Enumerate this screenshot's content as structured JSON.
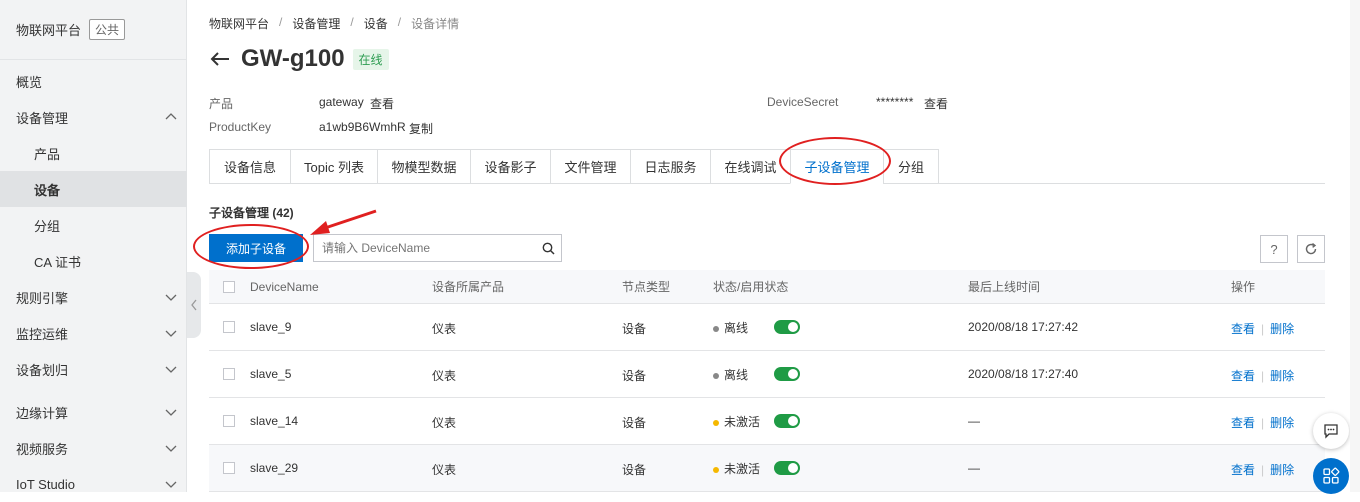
{
  "sidebar": {
    "title": "物联网平台",
    "tag": "公共",
    "items": [
      {
        "label": "概览"
      },
      {
        "label": "设备管理"
      },
      {
        "label": "产品"
      },
      {
        "label": "设备"
      },
      {
        "label": "分组"
      },
      {
        "label": "CA 证书"
      },
      {
        "label": "规则引擎"
      },
      {
        "label": "监控运维"
      },
      {
        "label": "设备划归"
      },
      {
        "label": "边缘计算"
      },
      {
        "label": "视频服务"
      },
      {
        "label": "IoT Studio"
      }
    ]
  },
  "breadcrumb": [
    "物联网平台",
    "设备管理",
    "设备",
    "设备详情"
  ],
  "device": {
    "name": "GW-g100",
    "status": "在线",
    "product_label": "产品",
    "product_value": "gateway",
    "product_link": "查看",
    "productkey_label": "ProductKey",
    "productkey_value": "a1wb9B6WmhR",
    "productkey_link": "复制",
    "secret_label": "DeviceSecret",
    "secret_value": "********",
    "secret_link": "查看"
  },
  "tabs": [
    "设备信息",
    "Topic 列表",
    "物模型数据",
    "设备影子",
    "文件管理",
    "日志服务",
    "在线调试",
    "子设备管理",
    "分组"
  ],
  "subdevices": {
    "title": "子设备管理 (42)",
    "add_button": "添加子设备",
    "search_placeholder": "请输入 DeviceName",
    "help_icon": "?",
    "columns": [
      "DeviceName",
      "设备所属产品",
      "节点类型",
      "状态/启用状态",
      "最后上线时间",
      "操作"
    ],
    "rows": [
      {
        "name": "slave_9",
        "product": "仪表",
        "node": "设备",
        "status": "离线",
        "status_color": "#888888",
        "enabled": true,
        "last_online": "2020/08/18 17:27:42",
        "view": "查看",
        "delete": "删除"
      },
      {
        "name": "slave_5",
        "product": "仪表",
        "node": "设备",
        "status": "离线",
        "status_color": "#888888",
        "enabled": true,
        "last_online": "2020/08/18 17:27:40",
        "view": "查看",
        "delete": "删除"
      },
      {
        "name": "slave_14",
        "product": "仪表",
        "node": "设备",
        "status": "未激活",
        "status_color": "#f5b800",
        "enabled": true,
        "last_online": "—",
        "view": "查看",
        "delete": "删除"
      },
      {
        "name": "slave_29",
        "product": "仪表",
        "node": "设备",
        "status": "未激活",
        "status_color": "#f5b800",
        "enabled": true,
        "last_online": "—",
        "view": "查看",
        "delete": "删除"
      }
    ]
  },
  "colors": {
    "primary": "#0070cc",
    "online_green": "#2e9d52",
    "toggle_green": "#1f9b45",
    "annotation_red": "#e02020"
  }
}
